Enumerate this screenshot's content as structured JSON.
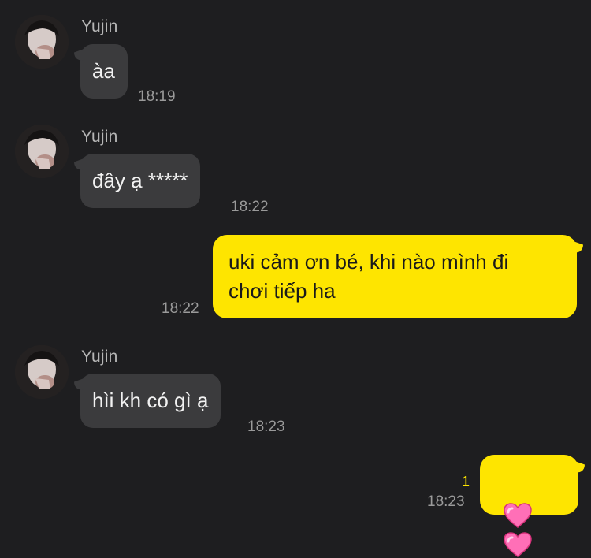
{
  "messages": [
    {
      "type": "in",
      "sender": "Yujin",
      "text": "àa",
      "time": "18:19"
    },
    {
      "type": "in",
      "sender": "Yujin",
      "text": "đây ạ *****",
      "time": "18:22"
    },
    {
      "type": "out",
      "text": "uki cảm ơn bé, khi nào mình đi\nchơi tiếp ha",
      "time": "18:22"
    },
    {
      "type": "in",
      "sender": "Yujin",
      "text": "hìi kh có gì ạ",
      "time": "18:23"
    },
    {
      "type": "out",
      "text": "💗💗",
      "time": "18:23",
      "unread": "1",
      "icons": [
        "heart-icon",
        "heart-icon"
      ]
    }
  ],
  "colors": {
    "background": "#1e1e20",
    "incoming_bubble": "#3b3b3d",
    "outgoing_bubble": "#fee500",
    "unread": "#fee500",
    "heart": "#ff6fb7"
  }
}
